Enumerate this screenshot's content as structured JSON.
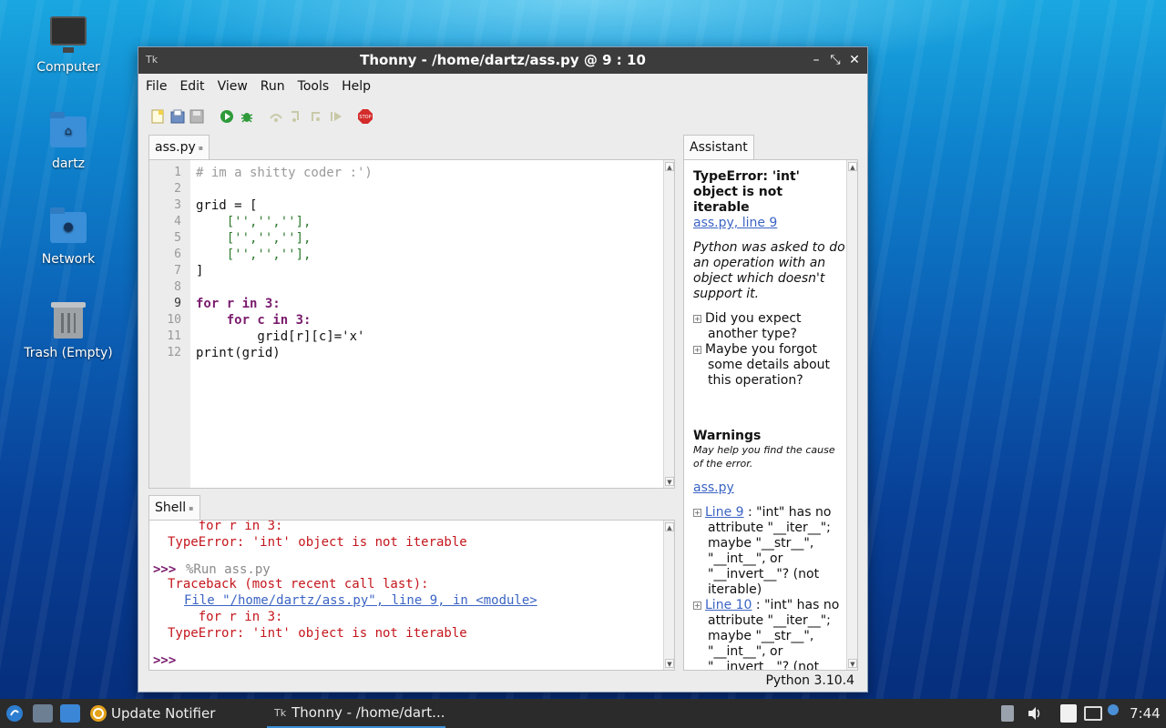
{
  "desktop": {
    "icons": [
      {
        "label": "Computer"
      },
      {
        "label": "dartz"
      },
      {
        "label": "Network"
      },
      {
        "label": "Trash (Empty)"
      }
    ]
  },
  "window": {
    "title": "Thonny  -  /home/dartz/ass.py  @  9 : 10",
    "app_icon": "Tk",
    "controls": {
      "minimize": "–",
      "maximize": "⤡",
      "close": "✕"
    }
  },
  "menu": [
    "File",
    "Edit",
    "View",
    "Run",
    "Tools",
    "Help"
  ],
  "toolbar": {
    "icons": [
      "new-file-icon",
      "open-file-icon",
      "save-file-icon",
      "run-icon",
      "debug-icon",
      "step-over-icon",
      "step-into-icon",
      "step-out-icon",
      "resume-icon",
      "stop-icon"
    ],
    "stop_label": "STOP"
  },
  "editor": {
    "tab_label": "ass.py",
    "line_numbers": [
      "1",
      "2",
      "3",
      "4",
      "5",
      "6",
      "7",
      "8",
      "9",
      "10",
      "11",
      "12"
    ],
    "lines": [
      "# im a shitty coder :')",
      "",
      "grid = [",
      "    ['','',''],",
      "    ['','',''],",
      "    ['','',''],",
      "]",
      "",
      "for r in 3:",
      "    for c in 3:",
      "        grid[r][c]='x'",
      "print(grid)"
    ]
  },
  "shell": {
    "tab_label": "Shell",
    "lines": {
      "l1": "    for r in 3:",
      "l2": "TypeError: 'int' object is not iterable",
      "prompt1": ">>>",
      "run_cmd": "%Run ass.py",
      "traceback": "Traceback (most recent call last):",
      "file_link": "File \"/home/dartz/ass.py\", line 9, in <module>",
      "l5": "    for r in 3:",
      "l6": "TypeError: 'int' object is not iterable",
      "prompt2": ">>>"
    }
  },
  "assistant": {
    "tab_label": "Assistant",
    "error_title_1": "TypeError: 'int'",
    "error_title_2": "object is not",
    "error_title_3": "iterable",
    "error_link": "ass.py, line 9",
    "explain": [
      "Python was asked to do",
      "an operation with an",
      "object which doesn't",
      "support it."
    ],
    "hint1": [
      "Did you expect",
      "another type?"
    ],
    "hint2": [
      "Maybe you forgot",
      "some details about",
      "this operation?"
    ],
    "warnings_title": "Warnings",
    "warnings_sub": [
      "May help you find the cause",
      "of the error."
    ],
    "warnings_file": "ass.py",
    "w1_link": "Line 9",
    "w1_text": [
      " : \"int\" has no",
      "attribute \"__iter__\";",
      "maybe \"__str__\",",
      "\"__int__\", or",
      "\"__invert__\"? (not",
      "iterable)"
    ],
    "w2_link": "Line 10",
    "w2_text": [
      " : \"int\" has no",
      "attribute \"__iter__\";",
      "maybe \"__str__\",",
      "\"__int__\", or",
      "\"__invert__\"? (not"
    ]
  },
  "statusbar": {
    "python_version": "Python 3.10.4"
  },
  "taskbar": {
    "items": [
      {
        "label": "Update Notifier"
      },
      {
        "label": "Thonny  -  /home/dart..."
      }
    ],
    "clock": "7:44"
  },
  "colors": {
    "keyword": "#7a1b6e",
    "number": "#b57700",
    "string": "#2d7a2d",
    "error": "#c4161c",
    "link": "#3b64c4",
    "titlebar": "#3c3c3c",
    "taskbar": "#2b2b2b"
  }
}
